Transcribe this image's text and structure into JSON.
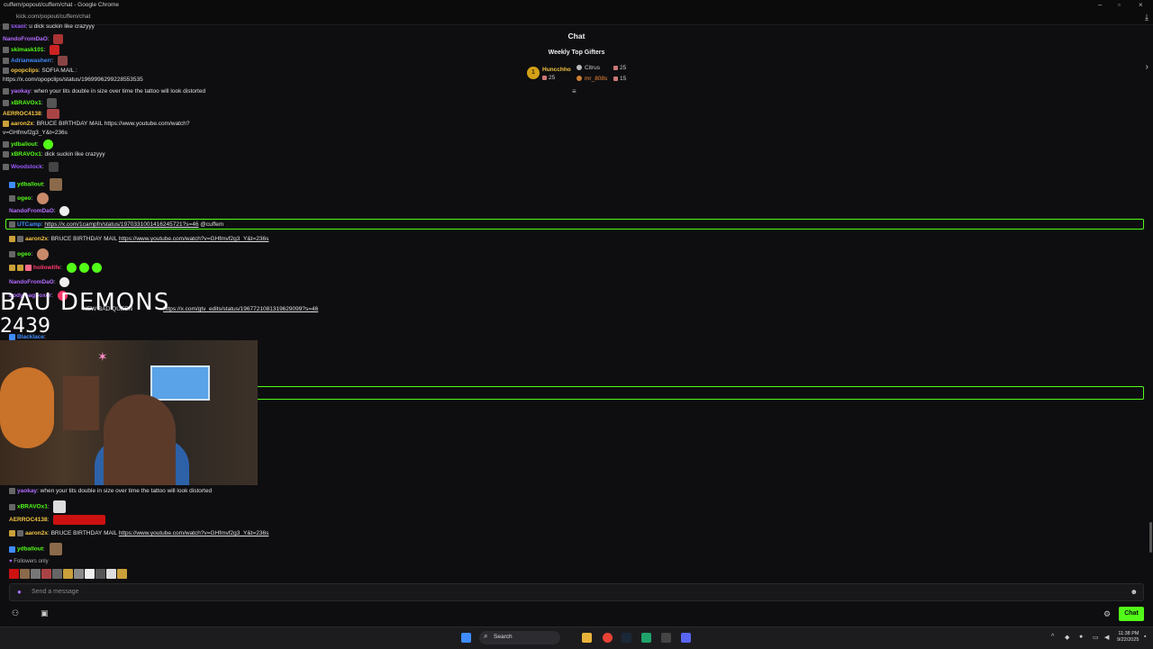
{
  "window": {
    "title": "cuffem/popout/cuffem/chat - Google Chrome",
    "url": "kick.com/popout/cuffem/chat"
  },
  "chat": {
    "title": "Chat",
    "top_gifters_title": "Weekly Top Gifters",
    "gifters": [
      {
        "rank": "1",
        "name": "Huncchho",
        "count": "25"
      },
      {
        "name": "Citrus",
        "count": "25"
      },
      {
        "name": "mr_808s",
        "count": "15"
      }
    ],
    "messages_top": [
      {
        "user": "sxaoi",
        "color": "#9b59ff",
        "text": "u dick suckin like crazyyy"
      },
      {
        "user": "NandoFromDaO",
        "color": "#b36bff",
        "text": ""
      },
      {
        "user": "skimask101",
        "color": "#53fc18",
        "text": ""
      },
      {
        "user": "Adrianwasherr",
        "color": "#3f8cff",
        "text": ""
      },
      {
        "user": "opopclips",
        "color": "#f5c542",
        "text": "SOFIA MAIL :"
      },
      {
        "user": "",
        "color": "#dfe0e1",
        "text": "https://x.com/opopclips/status/1969996299228553535"
      },
      {
        "user": "yaokay",
        "color": "#b36bff",
        "text": "when your tits double in size over time the tattoo will look distorted"
      }
    ],
    "messages_mid": [
      {
        "user": "xBRAVOx1",
        "color": "#53fc18",
        "text": ""
      },
      {
        "user": "AERROC4138",
        "color": "#f5c542",
        "text": ""
      },
      {
        "user": "aaron2x",
        "color": "#f5c542",
        "text": "BRUCE BIRTHDAY MAIL https://www.youtube.com/watch?"
      },
      {
        "user": "",
        "color": "#dfe0e1",
        "text": "v=GHfmvf2g3_Y&t=236s"
      },
      {
        "user": "ydballout",
        "color": "#53fc18",
        "text": ""
      },
      {
        "user": "xBRAVOx1",
        "color": "#53fc18",
        "text": "dick suckin like crazyyy"
      },
      {
        "user": "Woodstock",
        "color": "#9b59ff",
        "text": ""
      }
    ],
    "messages_main": [
      {
        "user": "ydballout",
        "color": "#53fc18",
        "text": ""
      },
      {
        "user": "ogeo",
        "color": "#53fc18",
        "text": ""
      },
      {
        "user": "NandoFromDaO",
        "color": "#b36bff",
        "text": ""
      },
      {
        "user": "UTCamp",
        "color": "#3f8cff",
        "link": "https://x.com/1campfn/status/1970331001416245721?s=46",
        "text": " @cuffem"
      },
      {
        "user": "aaron2x",
        "color": "#f5c542",
        "text": "BRUCE BIRTHDAY MAIL ",
        "link": "https://www.youtube.com/watch?v=GHfmvf2g3_Y&t=236s"
      },
      {
        "user": "ogeo",
        "color": "#53fc18",
        "text": ""
      },
      {
        "user": "hollowlife",
        "color": "#ff3b6b",
        "text": ""
      },
      {
        "user": "NandoFromDaO",
        "color": "#b36bff",
        "text": ""
      },
      {
        "user": "bodyfbagboxer",
        "color": "#b36bff",
        "text": ""
      },
      {
        "user": "",
        "color": "#dfe0e1",
        "text": "NEW BAD QUEEN ",
        "link": "https://x.com/gtv_edits/status/1967721081319629099?s=46"
      },
      {
        "user": "Blacklace",
        "color": "#3f8cff",
        "text": ""
      }
    ],
    "messages_bottom": [
      {
        "user": "yaokay",
        "color": "#b36bff",
        "text": "when your tits double in size over time the tattoo will look distorted"
      },
      {
        "user": "xBRAVOx1",
        "color": "#53fc18",
        "text": ""
      },
      {
        "user": "AERROC4138",
        "color": "#f5c542",
        "text": ""
      },
      {
        "user": "aaron2x",
        "color": "#f5c542",
        "text": "BRUCE BIRTHDAY MAIL ",
        "link": "https://www.youtube.com/watch?v=GHfmvf2g3_Y&t=236s"
      },
      {
        "user": "ydballout",
        "color": "#53fc18",
        "text": ""
      }
    ],
    "followers_only": "Followers only",
    "input_placeholder": "Send a message",
    "send_button": "Chat"
  },
  "overlay": {
    "title": "BAU DEMONS",
    "count": "2439"
  },
  "taskbar": {
    "search_label": "Search",
    "time": "11:38 PM",
    "date": "9/22/2025"
  },
  "colors": {
    "accent": "#53fc18",
    "background": "#0e0e10"
  }
}
